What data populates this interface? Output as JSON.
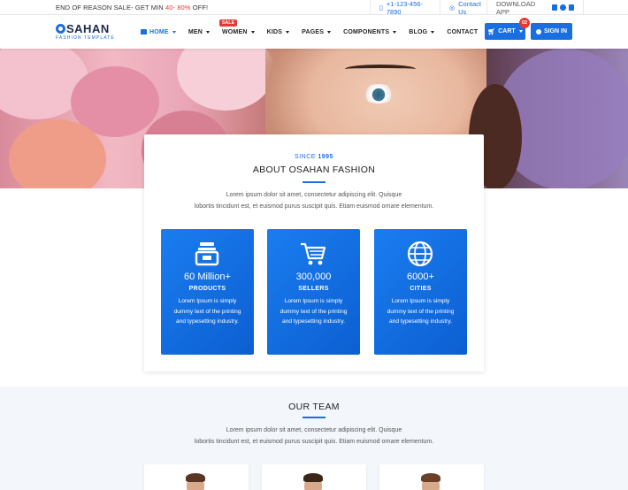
{
  "topbar": {
    "promo_prefix": "END OF REASON SALE- GET MIN ",
    "promo_range": "40- 80%",
    "promo_suffix": " OFF!",
    "phone": "+1-123-456-7890",
    "contact": "Contact Us",
    "download": "DOWNLOAD APP"
  },
  "logo": {
    "name": "SAHAN",
    "tagline": "FASHION TEMPLATE"
  },
  "nav": {
    "items": [
      {
        "label": "HOME"
      },
      {
        "label": "MEN"
      },
      {
        "label": "WOMEN",
        "badge": "SALE"
      },
      {
        "label": "KIDS"
      },
      {
        "label": "PAGES"
      },
      {
        "label": "COMPONENTS"
      },
      {
        "label": "BLOG"
      },
      {
        "label": "CONTACT"
      }
    ],
    "cart_label": "CART",
    "cart_count": "02",
    "signin_label": "SIGN IN"
  },
  "about": {
    "since_prefix": "SINCE ",
    "since_year": "1995",
    "title": "ABOUT OSAHAN FASHION",
    "desc_line1": "Lorem ipsum dolor sit amet, consectetur adipiscing elit. Quisque",
    "desc_line2": "lobortis tincidunt est, et euismod purus suscipit quis. Etiam euismod ornare elementum."
  },
  "stats": [
    {
      "value": "60 Million+",
      "label": "PRODUCTS",
      "icon": "archive-box-icon",
      "desc": "Lorem Ipsum is simply dummy text of the printing and typesetting industry."
    },
    {
      "value": "300,000",
      "label": "SELLERS",
      "icon": "shopping-cart-icon",
      "desc": "Lorem Ipsum is simply dummy text of the printing and typesetting industry."
    },
    {
      "value": "6000+",
      "label": "CITIES",
      "icon": "globe-icon",
      "desc": "Lorem Ipsum is simply dummy text of the printing and typesetting industry."
    }
  ],
  "team": {
    "title": "OUR TEAM",
    "desc_line1": "Lorem ipsum dolor sit amet, consectetur adipiscing elit. Quisque",
    "desc_line2": "lobortis tincidunt est, et euismod purus suscipit quis. Etiam euismod ornare elementum."
  },
  "colors": {
    "accent": "#1a6fe0",
    "sale": "#e53935",
    "brand_dark": "#1c2a4a"
  }
}
